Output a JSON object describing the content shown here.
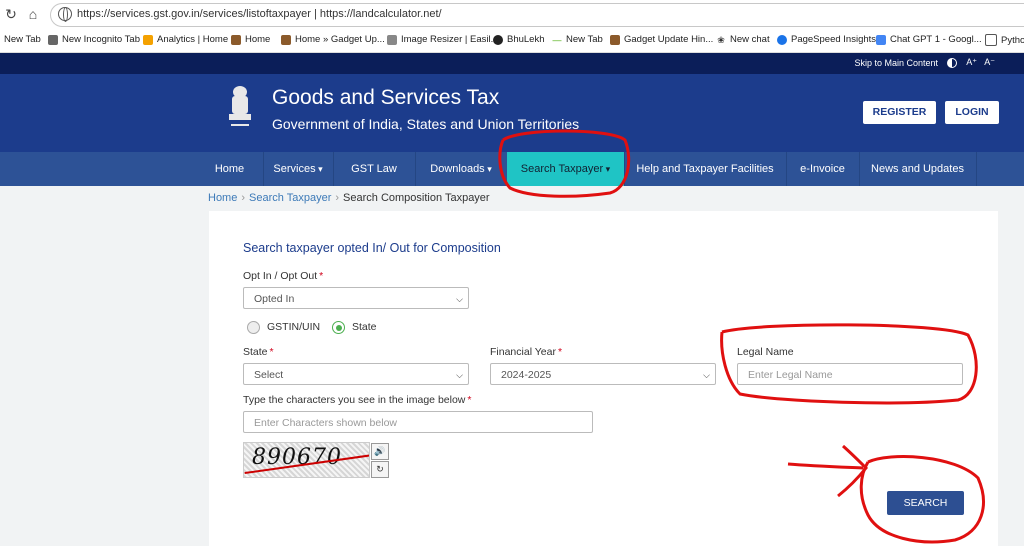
{
  "browser": {
    "url": "https://services.gst.gov.in/services/listoftaxpayer | https://landcalculator.net/",
    "bookmarks": [
      "New Tab",
      "New Incognito Tab",
      "Analytics | Home",
      "Home",
      "Home » Gadget Up...",
      "Image Resizer | Easil...",
      "BhuLekh",
      "New Tab",
      "Gadget Update Hin...",
      "New chat",
      "PageSpeed Insights",
      "Chat GPT 1 - Googl...",
      "Python"
    ]
  },
  "topstrip": {
    "skip": "Skip to Main Content",
    "font_increase": "A⁺",
    "font_decrease": "A⁻"
  },
  "header": {
    "title": "Goods and Services Tax",
    "subtitle": "Government of India, States and Union Territories",
    "register": "REGISTER",
    "login": "LOGIN"
  },
  "nav": [
    "Home",
    "Services",
    "GST Law",
    "Downloads",
    "Search Taxpayer",
    "Help and Taxpayer Facilities",
    "e-Invoice",
    "News and Updates"
  ],
  "breadcrumb": {
    "home": "Home",
    "search": "Search Taxpayer",
    "current": "Search Composition Taxpayer"
  },
  "form": {
    "title": "Search taxpayer opted In/ Out for Composition",
    "optin_label": "Opt In / Opt Out",
    "optin_value": "Opted In",
    "radio_gstin": "GSTIN/UIN",
    "radio_state": "State",
    "state_label": "State",
    "state_value": "Select",
    "fy_label": "Financial Year",
    "fy_value": "2024-2025",
    "legal_label": "Legal Name",
    "legal_placeholder": "Enter Legal Name",
    "captcha_label": "Type the characters you see in the image below",
    "captcha_placeholder": "Enter Characters shown below",
    "captcha_text": "890670",
    "search": "SEARCH"
  },
  "colors": {
    "header_bg": "#1c3c8c",
    "nav_bg": "#2d5296",
    "active_tab": "#1fc4c5",
    "annotation": "#e01010"
  }
}
